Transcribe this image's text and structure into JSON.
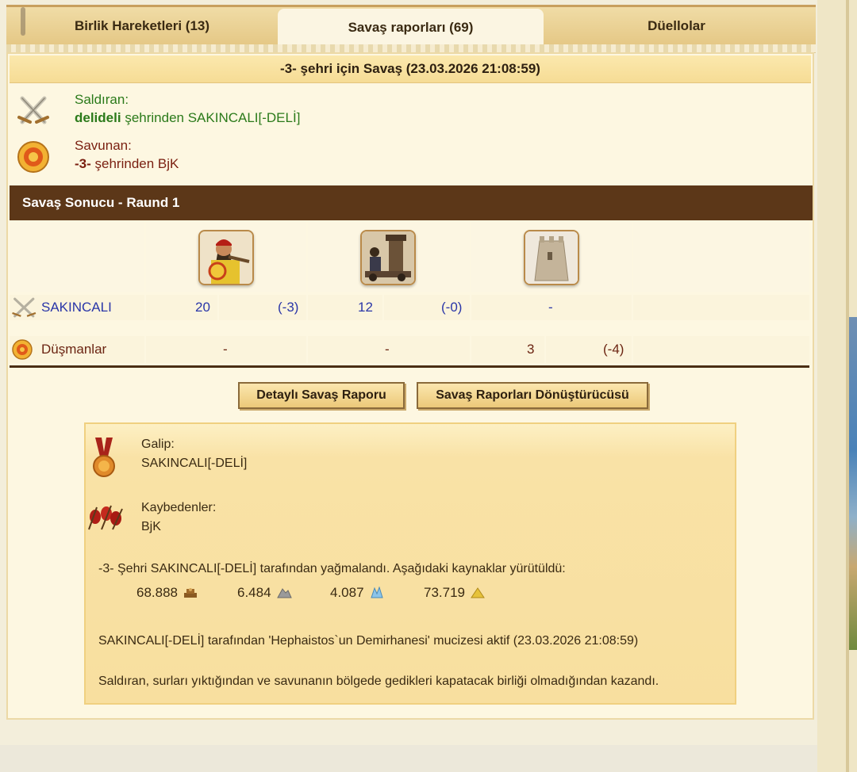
{
  "tabs": [
    {
      "label": "Birlik Hareketleri (13)"
    },
    {
      "label": "Savaş raporları (69)"
    },
    {
      "label": "Düellolar"
    }
  ],
  "battle_title": "-3- şehri için Savaş (23.03.2026 21:08:59)",
  "attacker": {
    "label": "Saldıran:",
    "city": "delideli",
    "suffix": "şehrinden SAKINCALI[-DELİ]"
  },
  "defender": {
    "label": "Savunan:",
    "city": "-3-",
    "suffix": "şehrinden BjK"
  },
  "round_title": "Savaş Sonucu - Raund 1",
  "unit_columns": [
    {
      "icon": "hoplite-unit-icon"
    },
    {
      "icon": "catapult-unit-icon"
    },
    {
      "icon": "wall-unit-icon"
    }
  ],
  "rows": [
    {
      "name": "SAKINCALI",
      "cells": [
        {
          "count": "20",
          "loss": "(-3)"
        },
        {
          "count": "12",
          "loss": "(-0)"
        },
        {
          "count": "-",
          "loss": ""
        }
      ]
    },
    {
      "name": "Düşmanlar",
      "cells": [
        {
          "count": "-",
          "loss": ""
        },
        {
          "count": "-",
          "loss": ""
        },
        {
          "count": "3",
          "loss": "(-4)"
        }
      ]
    }
  ],
  "buttons": {
    "detailed": "Detaylı Savaş Raporu",
    "converter": "Savaş Raporları Dönüştürücüsü"
  },
  "result": {
    "winner_label": "Galip:",
    "winner": "SAKINCALI[-DELİ]",
    "losers_label": "Kaybedenler:",
    "losers": "BjK",
    "pillage_text": "-3- Şehri SAKINCALI[-DELİ] tarafından yağmalandı. Aşağıdaki kaynaklar yürütüldü:",
    "resources": [
      {
        "amount": "68.888",
        "icon": "wood-icon"
      },
      {
        "amount": "6.484",
        "icon": "marble-icon"
      },
      {
        "amount": "4.087",
        "icon": "crystal-icon"
      },
      {
        "amount": "73.719",
        "icon": "sulfur-icon"
      }
    ],
    "wonder_text": "SAKINCALI[-DELİ] tarafından 'Hephaistos`un Demirhanesi' mucizesi aktif (23.03.2026 21:08:59)",
    "outcome_text": "Saldıran, surları yıktığından ve savunanın bölgede gedikleri kapatacak birliği olmadığından kazandı."
  },
  "colors": {
    "attacker_green": "#2b7a1a",
    "defender_red": "#7a1f10",
    "round_bar_brown": "#5c3718",
    "unit_count_blue": "#2a36a8"
  }
}
